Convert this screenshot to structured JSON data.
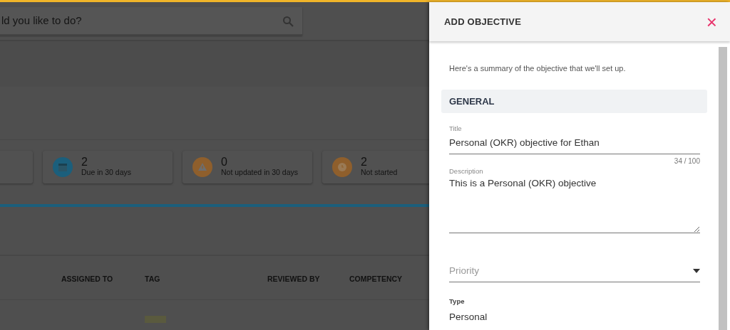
{
  "search": {
    "placeholder": "ld you like to do?"
  },
  "stats": [
    {
      "kind": "blank"
    },
    {
      "kind": "calendar",
      "value": "2",
      "label": "Due in 30 days",
      "color": "#1b5f7c"
    },
    {
      "kind": "warning",
      "value": "0",
      "label": "Not updated in 30 days",
      "color": "#8f5f2c"
    },
    {
      "kind": "clock",
      "value": "2",
      "label": "Not started",
      "color": "#8f5f2c"
    }
  ],
  "table": {
    "columns": [
      "ASSIGNED TO",
      "TAG",
      "REVIEWED BY",
      "COMPETENCY"
    ]
  },
  "panel": {
    "title": "ADD OBJECTIVE",
    "close": "×",
    "intro": "Here's a summary of the objective that we'll set up.",
    "section": "GENERAL",
    "fields": [
      {
        "kind": "text",
        "label": "Title",
        "value": "Personal (OKR) objective for Ethan",
        "counter": "34 / 100"
      },
      {
        "kind": "textarea",
        "label": "Description",
        "value": "This is a Personal (OKR) objective"
      },
      {
        "kind": "select",
        "placeholder": "Priority"
      },
      {
        "kind": "static",
        "label": "Type",
        "value": "Personal"
      }
    ]
  }
}
